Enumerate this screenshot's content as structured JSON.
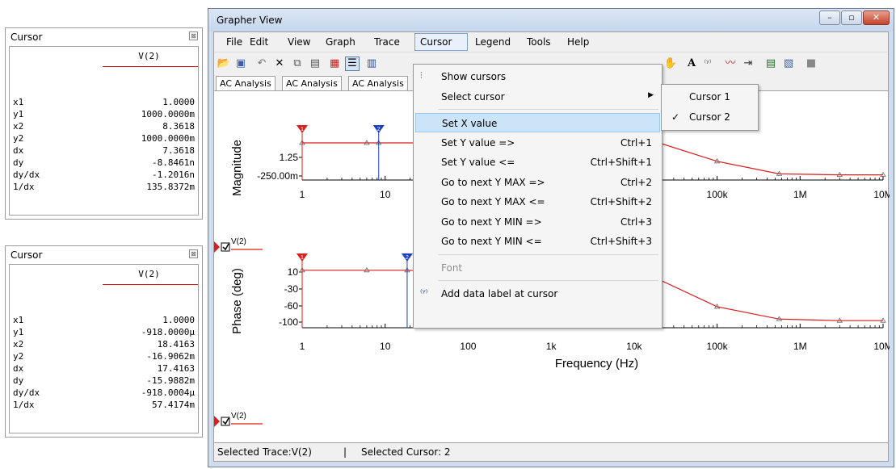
{
  "cursor_panels": [
    {
      "title": "Cursor",
      "close_glyph": "⊠",
      "trace": "V(2)",
      "rows": [
        {
          "label": "x1",
          "value": "1.0000"
        },
        {
          "label": "y1",
          "value": "1000.0000m"
        },
        {
          "label": "x2",
          "value": "8.3618"
        },
        {
          "label": "y2",
          "value": "1000.0000m"
        },
        {
          "label": "dx",
          "value": "7.3618"
        },
        {
          "label": "dy",
          "value": "-8.8461n"
        },
        {
          "label": "dy/dx",
          "value": "-1.2016n"
        },
        {
          "label": "1/dx",
          "value": "135.8372m"
        }
      ]
    },
    {
      "title": "Cursor",
      "close_glyph": "⊠",
      "trace": "V(2)",
      "rows": [
        {
          "label": "x1",
          "value": "1.0000"
        },
        {
          "label": "y1",
          "value": "-918.0000µ"
        },
        {
          "label": "x2",
          "value": "18.4163"
        },
        {
          "label": "y2",
          "value": "-16.9062m"
        },
        {
          "label": "dx",
          "value": "17.4163"
        },
        {
          "label": "dy",
          "value": "-15.9882m"
        },
        {
          "label": "dy/dx",
          "value": "-918.0004µ"
        },
        {
          "label": "1/dx",
          "value": "57.4174m"
        }
      ]
    }
  ],
  "window": {
    "title": "Grapher View",
    "menu": [
      "File",
      "Edit",
      "View",
      "Graph",
      "Trace",
      "Cursor",
      "Legend",
      "Tools",
      "Help"
    ],
    "open_menu": "Cursor",
    "tabs": [
      "AC Analysis",
      "AC Analysis",
      "AC Analysis"
    ],
    "status": {
      "trace": "Selected Trace:V(2)",
      "sep": "|",
      "cursor": "Selected Cursor: 2"
    },
    "toolbar_icons": [
      "open-icon",
      "save-icon",
      "undo-icon",
      "delete-icon",
      "copy-icon",
      "paste-icon",
      "grid-icon",
      "legend-icon",
      "cursor-icon",
      "pan-hand-icon",
      "text-icon",
      "label-icon",
      "trace-icon",
      "export-icon",
      "print-icon",
      "print-preview-icon",
      "stop-icon"
    ]
  },
  "cursor_menu": [
    {
      "label": "Show cursors",
      "shortcut": "",
      "icon": "show-cursors-icon"
    },
    {
      "label": "Select cursor",
      "shortcut": "",
      "submenu": true
    },
    {
      "sep": true
    },
    {
      "label": "Set X value",
      "shortcut": "",
      "highlight": true
    },
    {
      "label": "Set Y value =>",
      "shortcut": "Ctrl+1"
    },
    {
      "label": "Set Y value <=",
      "shortcut": "Ctrl+Shift+1"
    },
    {
      "label": "Go to next Y MAX =>",
      "shortcut": "Ctrl+2"
    },
    {
      "label": "Go to next Y MAX <=",
      "shortcut": "Ctrl+Shift+2"
    },
    {
      "label": "Go to next Y MIN =>",
      "shortcut": "Ctrl+3"
    },
    {
      "label": "Go to next Y MIN <=",
      "shortcut": "Ctrl+Shift+3"
    },
    {
      "sep": true
    },
    {
      "label": "Font",
      "shortcut": "",
      "disabled": true
    },
    {
      "sep": true
    },
    {
      "label": "Add data label at cursor",
      "shortcut": "",
      "icon": "data-label-icon"
    }
  ],
  "cursor_submenu": [
    {
      "label": "Cursor 1",
      "checked": false
    },
    {
      "label": "Cursor 2",
      "checked": true
    }
  ],
  "chart_data": [
    {
      "type": "line",
      "ylabel": "Magnitude",
      "yticks": [
        "1.25",
        "-250.00m"
      ],
      "x_scale": "log",
      "xticks": [
        "1",
        "10",
        "100k",
        "1M",
        "10M"
      ],
      "legend": "V(2)",
      "cursors": [
        {
          "id": "1",
          "x": 1.0
        },
        {
          "id": "2",
          "x": 8.3618
        }
      ],
      "series": [
        {
          "name": "V(2)",
          "x": [
            1,
            6,
            8.36,
            20000,
            100000,
            560000,
            3000000,
            10000000
          ],
          "y": [
            1.0,
            1.0,
            1.0,
            1.0,
            0.62,
            0.36,
            0.34,
            0.34
          ]
        }
      ]
    },
    {
      "type": "line",
      "ylabel": "Phase (deg)",
      "yticks": [
        "10",
        "-30",
        "-60",
        "-100"
      ],
      "x_scale": "log",
      "xticks": [
        "1",
        "10",
        "100",
        "1k",
        "10k",
        "100k",
        "1M",
        "10M"
      ],
      "xlabel": "Frequency (Hz)",
      "legend": "V(2)",
      "cursors": [
        {
          "id": "1",
          "x": 1.0
        },
        {
          "id": "2",
          "x": 18.4163
        }
      ],
      "series": [
        {
          "name": "V(2)",
          "x": [
            1,
            6,
            18.4,
            20000,
            100000,
            560000,
            3000000,
            10000000
          ],
          "y": [
            0,
            0,
            0,
            -12,
            -47,
            -63,
            -65,
            -65
          ]
        }
      ]
    }
  ]
}
